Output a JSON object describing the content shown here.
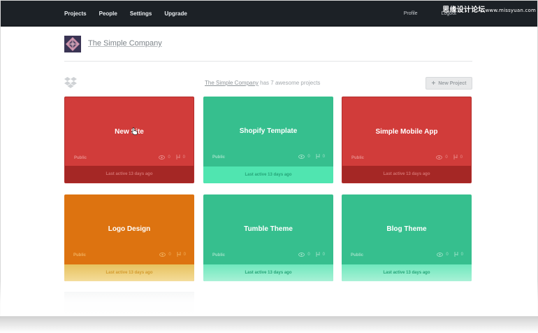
{
  "nav": {
    "items": [
      "Projects",
      "People",
      "Settings",
      "Upgrade"
    ],
    "right": [
      "Profile",
      "Logout"
    ]
  },
  "watermark": {
    "main": "思缘设计论坛",
    "small": "www.missyuan.com"
  },
  "company": {
    "name": "The Simple Company"
  },
  "summary": {
    "company_link": "The Simple Company",
    "text": " has 7 awesome projects"
  },
  "toolbar": {
    "new_project_label": "New Project"
  },
  "colors": {
    "red": "#d13c3a",
    "green": "#36bf8e",
    "orange": "#dd7310",
    "topbar": "#1c2126"
  },
  "projects": [
    {
      "title": "New Site",
      "visibility": "Public",
      "views": "0",
      "forks": "0",
      "last_active": "Last active 13 days ago",
      "color": "red"
    },
    {
      "title": "Shopify Template",
      "visibility": "Public",
      "views": "0",
      "forks": "0",
      "last_active": "Last active 13 days ago",
      "color": "green"
    },
    {
      "title": "Simple Mobile App",
      "visibility": "Public",
      "views": "0",
      "forks": "0",
      "last_active": "Last active 13 days ago",
      "color": "red"
    },
    {
      "title": "Logo Design",
      "visibility": "Public",
      "views": "0",
      "forks": "0",
      "last_active": "Last active 13 days ago",
      "color": "orange"
    },
    {
      "title": "Tumble Theme",
      "visibility": "Public",
      "views": "0",
      "forks": "0",
      "last_active": "Last active 13 days ago",
      "color": "green"
    },
    {
      "title": "Blog Theme",
      "visibility": "Public",
      "views": "0",
      "forks": "0",
      "last_active": "Last active 13 days ago",
      "color": "green"
    }
  ]
}
